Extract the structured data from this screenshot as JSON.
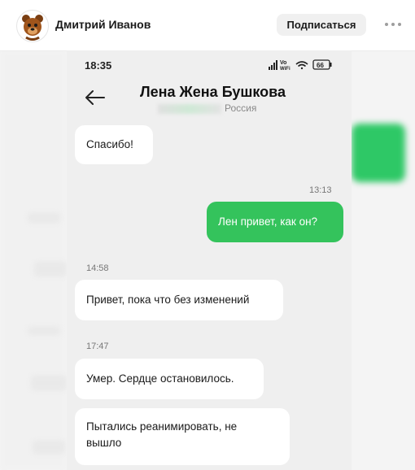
{
  "post": {
    "author": "Дмитрий Иванов",
    "subscribe_label": "Подписаться",
    "more_icon": "ellipsis-icon"
  },
  "phone": {
    "status_time": "18:35",
    "battery": "66",
    "wifi_label_top": "Vo",
    "wifi_label_bottom": "WiFi"
  },
  "chat": {
    "name": "Лена Жена Бушкова",
    "subtitle": "Россия",
    "messages": [
      {
        "direction": "in",
        "text": "Спасибо!"
      },
      {
        "direction": "out",
        "time": "13:13",
        "text": "Лен привет, как он?"
      },
      {
        "direction": "in",
        "time": "14:58",
        "text": "Привет, пока что без изменений"
      },
      {
        "direction": "in",
        "time": "17:47",
        "text": "Умер. Сердце остановилось."
      },
      {
        "direction": "in",
        "text": "Пытались реанимировать, не вышло"
      }
    ]
  },
  "colors": {
    "outgoing_bubble": "#34c35c",
    "incoming_bubble": "#ffffff",
    "chat_background": "#efefef"
  }
}
